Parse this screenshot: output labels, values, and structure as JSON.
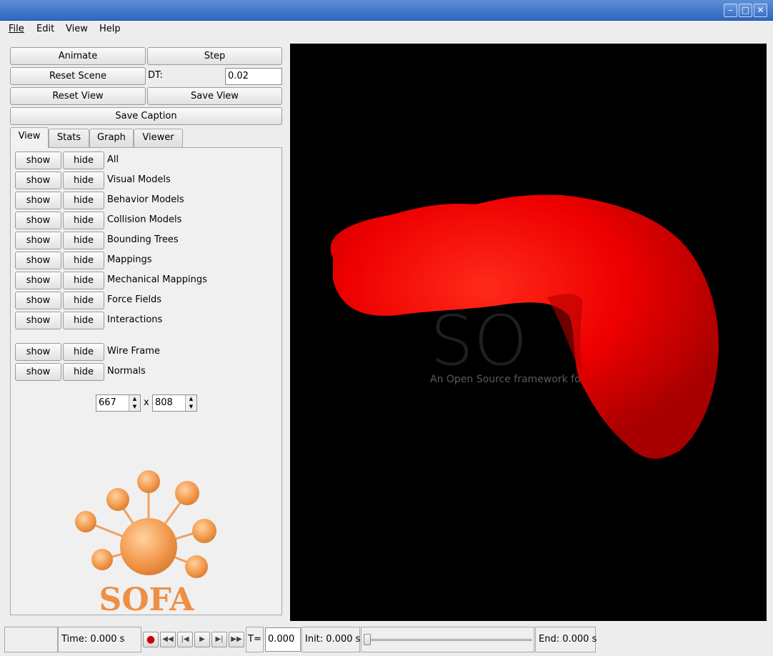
{
  "window": {
    "buttons": {
      "minimize": "–",
      "maximize": "□",
      "close": "✕"
    }
  },
  "menu": [
    "File",
    "Edit",
    "View",
    "Help"
  ],
  "controls": {
    "animate": "Animate",
    "step": "Step",
    "reset_scene": "Reset Scene",
    "dt_label": "DT:",
    "dt_value": "0.02",
    "reset_view": "Reset View",
    "save_view": "Save View",
    "save_caption": "Save Caption"
  },
  "tabs": [
    "View",
    "Stats",
    "Graph",
    "Viewer"
  ],
  "show_label": "show",
  "hide_label": "hide",
  "rows": [
    "All",
    "Visual Models",
    "Behavior Models",
    "Collision Models",
    "Bounding Trees",
    "Mappings",
    "Mechanical Mappings",
    "Force Fields",
    "Interactions"
  ],
  "rows2": [
    "Wire Frame",
    "Normals"
  ],
  "size": {
    "width": "667",
    "height": "808",
    "separator": "x"
  },
  "logo_text": "SOFA",
  "viewport": {
    "watermark": "SO",
    "tagline": "An Open Source framework for m"
  },
  "status": {
    "time": "Time: 0.000 s",
    "t_label": "T=",
    "t_value": "0.000",
    "init": "Init: 0.000 s",
    "end": "End: 0.000 s"
  },
  "colors": {
    "titlebar": "#2e66c2",
    "object": "#ff0000",
    "logo": "#f09a4e"
  }
}
